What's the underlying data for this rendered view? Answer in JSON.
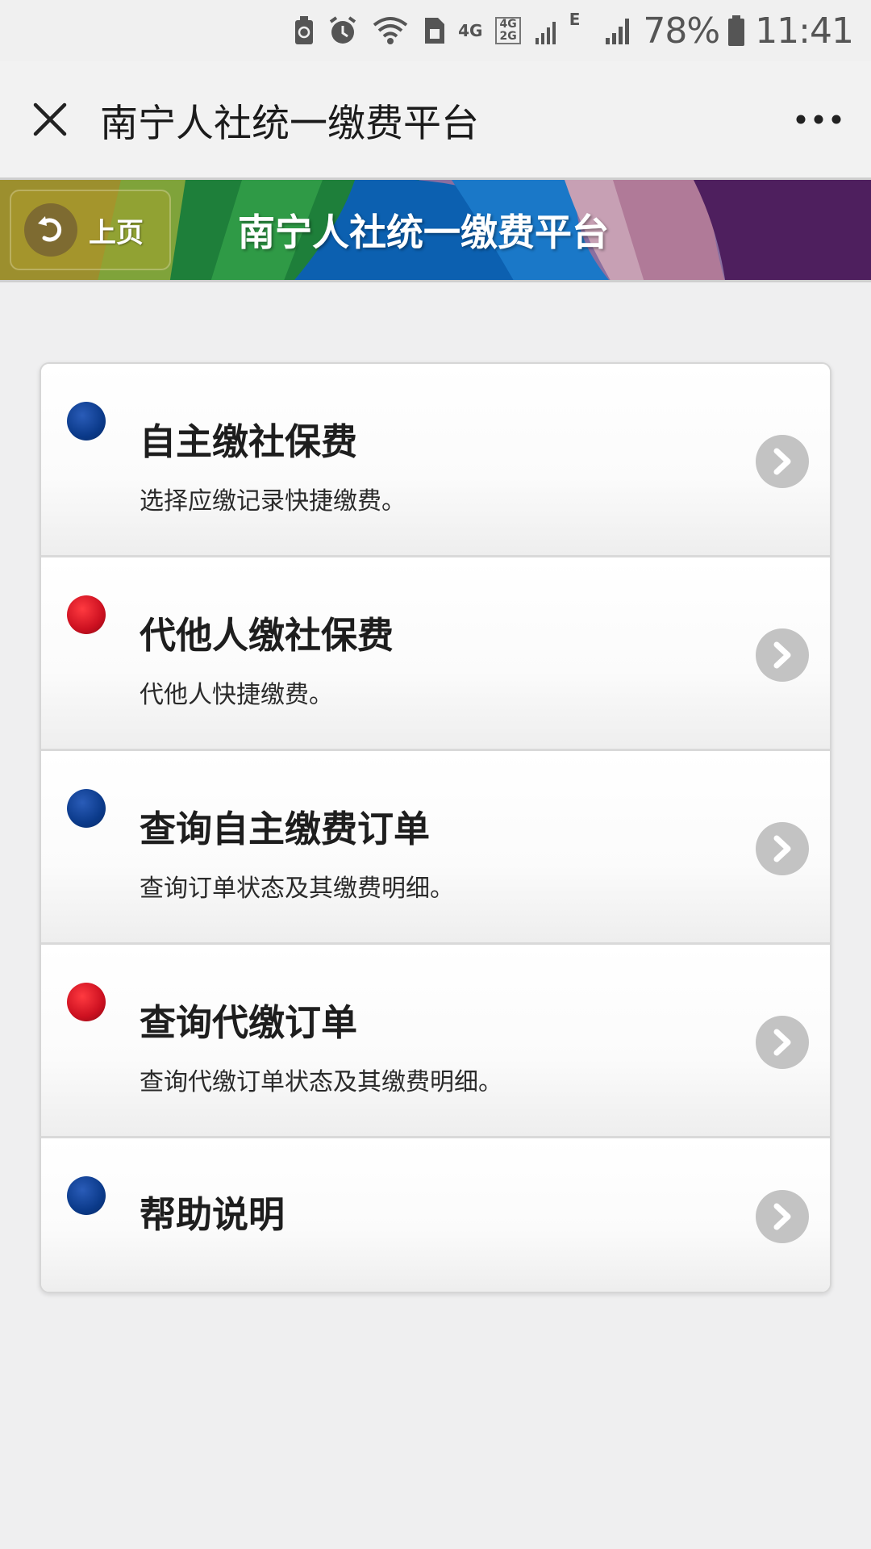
{
  "status_bar": {
    "network_4g": "4G",
    "network_4g2g_top": "4G",
    "network_4g2g_bottom": "2G",
    "network_e": "E",
    "battery_percent": "78%",
    "time": "11:41",
    "icons": [
      "recycle-battery-icon",
      "alarm-icon",
      "wifi-icon",
      "sim-icon",
      "signal-icon",
      "battery-icon"
    ]
  },
  "nav": {
    "title": "南宁人社统一缴费平台",
    "close_icon": "close-icon",
    "more_icon": "more-icon"
  },
  "banner": {
    "back_label": "上页",
    "title": "南宁人社统一缴费平台",
    "colors": [
      "#b89a2e",
      "#2a8a3a",
      "#0e5fa8",
      "#c09aa0",
      "#4a2060"
    ]
  },
  "menu": {
    "items": [
      {
        "title": "自主缴社保费",
        "desc": "选择应缴记录快捷缴费。",
        "dot_color": "#0b3a8a"
      },
      {
        "title": "代他人缴社保费",
        "desc": "代他人快捷缴费。",
        "dot_color": "#cc1020"
      },
      {
        "title": "查询自主缴费订单",
        "desc": "查询订单状态及其缴费明细。",
        "dot_color": "#0b3a8a"
      },
      {
        "title": "查询代缴订单",
        "desc": "查询代缴订单状态及其缴费明细。",
        "dot_color": "#cc1020"
      },
      {
        "title": "帮助说明",
        "desc": "",
        "dot_color": "#0b3a8a"
      }
    ]
  }
}
